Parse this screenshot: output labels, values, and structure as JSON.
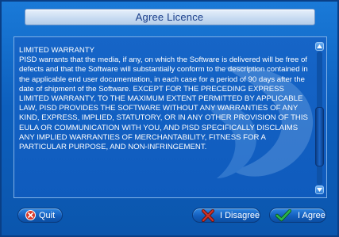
{
  "window": {
    "title": "Agree Licence"
  },
  "license": {
    "paragraphs": [
      "LIMITED WARRANTY",
      "PISD warrants that the media, if any, on which the Software is delivered will be free of defects and that the Software will substantially conform to the description contained in the applicable end user documentation, in each case for a period of 90 days after the date of shipment of the Software.  EXCEPT FOR THE PRECEDING EXPRESS LIMITED WARRANTY, TO THE MAXIMUM EXTENT PERMITTED BY APPLICABLE LAW, PISD PROVIDES THE SOFTWARE WITHOUT ANY WARRANTIES OF ANY KIND, EXPRESS, IMPLIED, STATUTORY, OR IN ANY OTHER PROVISION OF THIS EULA OR COMMUNICATION WITH YOU, AND PISD SPECIFICALLY DISCLAIMS ANY IMPLIED WARRANTIES OF MERCHANTABILITY, FITNESS FOR A PARTICULAR PURPOSE, AND NON-INFRINGEMENT."
    ]
  },
  "buttons": {
    "quit": {
      "label": "Quit",
      "icon": "quit-icon"
    },
    "disagree": {
      "label": "I Disagree",
      "icon": "x-icon"
    },
    "agree": {
      "label": "I Agree",
      "icon": "check-icon"
    }
  },
  "colors": {
    "window_background": "#0d5fbd",
    "title_text": "#1b3f8b",
    "body_text": "#ffffff",
    "quit_icon": "#d93a2b",
    "disagree_icon": "#c8322a",
    "agree_icon": "#29b34a"
  }
}
